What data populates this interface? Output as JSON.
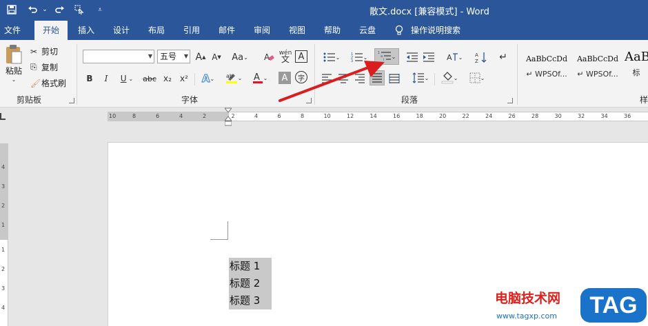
{
  "titlebar": {
    "title": "散文.docx [兼容模式] - Word",
    "quick_access": [
      "save-icon",
      "undo-icon",
      "redo-icon",
      "touch-mode-icon",
      "customize-icon"
    ]
  },
  "tabs": [
    {
      "label": "文件"
    },
    {
      "label": "开始"
    },
    {
      "label": "插入"
    },
    {
      "label": "设计"
    },
    {
      "label": "布局"
    },
    {
      "label": "引用"
    },
    {
      "label": "邮件"
    },
    {
      "label": "审阅"
    },
    {
      "label": "视图"
    },
    {
      "label": "帮助"
    },
    {
      "label": "云盘"
    },
    {
      "label": "操作说明搜索"
    }
  ],
  "clipboard": {
    "paste": "粘贴",
    "cut": "剪切",
    "copy": "复制",
    "format_painter": "格式刷",
    "group_label": "剪贴板"
  },
  "font": {
    "font_name": "",
    "font_size": "五号",
    "group_label": "字体",
    "bold": "B",
    "italic": "I",
    "underline": "U",
    "strike": "abc",
    "sub": "x₂",
    "sup": "x²",
    "grow": "A",
    "shrink": "A",
    "change_case": "Aa",
    "phonetic": "wén",
    "char_border": "A",
    "text_effect": "A",
    "font_color": "A",
    "char_shading": "A",
    "enclosed": "字"
  },
  "paragraph": {
    "group_label": "段落"
  },
  "styles": {
    "group_label": "样式",
    "items": [
      {
        "sample": "AaBbCcDd",
        "name": "WPSOf..."
      },
      {
        "sample": "AaBbCcDd",
        "name": "WPSOf..."
      },
      {
        "sample": "AaB",
        "name": "标"
      }
    ]
  },
  "ruler": {
    "h_labels": [
      "10",
      "8",
      "6",
      "4",
      "2",
      "2",
      "4",
      "6",
      "8",
      "10",
      "12",
      "14",
      "16",
      "18",
      "20",
      "22",
      "24",
      "26",
      "28",
      "30",
      "32",
      "34",
      "36"
    ],
    "v_labels": [
      "4",
      "3",
      "2",
      "1",
      "1",
      "2",
      "3",
      "4"
    ]
  },
  "document": {
    "lines": [
      "标题 1",
      "标题 2",
      "标题 3"
    ]
  },
  "watermark": {
    "site_name": "电脑技术网",
    "url": "www.tagxp.com",
    "badge": "TAG"
  },
  "colors": {
    "title_bar": "#2b579a",
    "highlight": "#ffff00",
    "font_color": "#e81123",
    "arrow": "#d81e1e",
    "watermark_red": "#e0201b",
    "badge_blue": "#1a73c8"
  }
}
